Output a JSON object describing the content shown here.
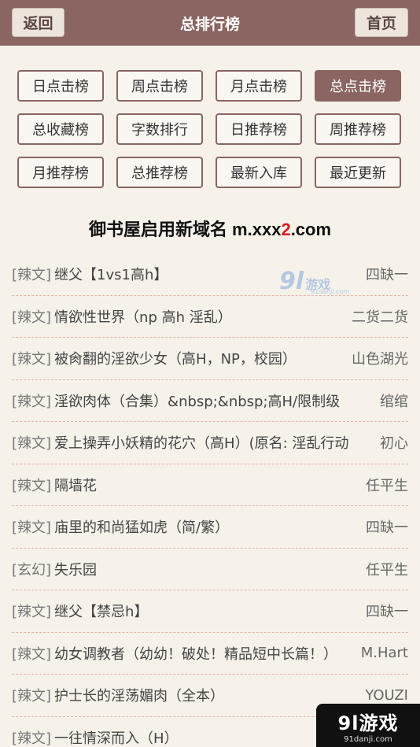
{
  "header": {
    "back_label": "返回",
    "title": "总排行榜",
    "home_label": "首页"
  },
  "tabs": [
    {
      "label": "日点击榜",
      "active": false
    },
    {
      "label": "周点击榜",
      "active": false
    },
    {
      "label": "月点击榜",
      "active": false
    },
    {
      "label": "总点击榜",
      "active": true
    },
    {
      "label": "总收藏榜",
      "active": false
    },
    {
      "label": "字数排行",
      "active": false
    },
    {
      "label": "日推荐榜",
      "active": false
    },
    {
      "label": "周推荐榜",
      "active": false
    },
    {
      "label": "月推荐榜",
      "active": false
    },
    {
      "label": "总推荐榜",
      "active": false
    },
    {
      "label": "最新入库",
      "active": false
    },
    {
      "label": "最近更新",
      "active": false
    }
  ],
  "notice": {
    "prefix": "御书屋启用新域名 m.xxx",
    "highlight": "2",
    "suffix": ".com"
  },
  "books": [
    {
      "category": "[辣文]",
      "title": "继父【1vs1高h】",
      "author": "四缺一"
    },
    {
      "category": "[辣文]",
      "title": "情欲性世界（np 高h 淫乱）",
      "author": "二货二货"
    },
    {
      "category": "[辣文]",
      "title": "被肏翻的淫欲少女（高H，NP，校园）",
      "author": "山色湖光"
    },
    {
      "category": "[辣文]",
      "title": "淫欲肉体（合集）&nbsp;&nbsp;高H/限制级",
      "author": "绾绾"
    },
    {
      "category": "[辣文]",
      "title": "爱上操弄小妖精的花穴（高H）(原名: 淫乱行动",
      "author": "初心"
    },
    {
      "category": "[辣文]",
      "title": "隔墙花",
      "author": "任平生"
    },
    {
      "category": "[辣文]",
      "title": "庙里的和尚猛如虎（简/繁）",
      "author": "四缺一"
    },
    {
      "category": "[玄幻]",
      "title": "失乐园",
      "author": "任平生"
    },
    {
      "category": "[辣文]",
      "title": "继父【禁忌h】",
      "author": "四缺一"
    },
    {
      "category": "[辣文]",
      "title": "幼女调教者（幼幼！破处！精品短中长篇！）",
      "author": "M.Hart"
    },
    {
      "category": "[辣文]",
      "title": "护士长的淫荡媚肉（全本）",
      "author": "YOUZI"
    },
    {
      "category": "[辣文]",
      "title": "一往情深而入（H）",
      "author": ""
    }
  ],
  "watermark": {
    "logo": "9l",
    "text": "游戏",
    "url": "91danji.com"
  },
  "badge": {
    "logo": "9l游戏",
    "url": "91danji.com"
  },
  "colors": {
    "brand": "#8a6561",
    "background": "#f6f2ea",
    "divider": "#e4b3a8",
    "highlight": "#d81e1e"
  }
}
